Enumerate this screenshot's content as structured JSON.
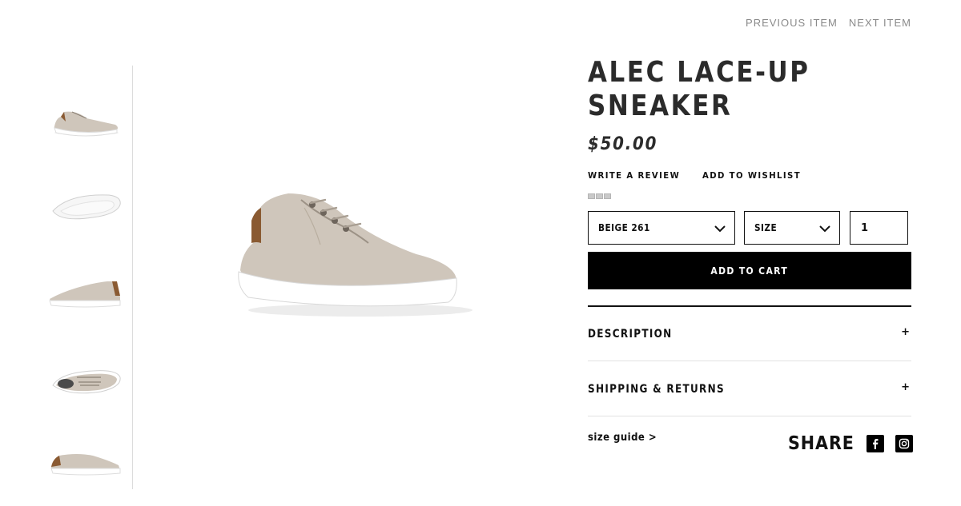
{
  "nav": {
    "previous": "PREVIOUS ITEM",
    "next": "NEXT ITEM"
  },
  "product": {
    "title": "ALEC LACE-UP SNEAKER",
    "price": "$50.00",
    "write_review": "WRITE A REVIEW",
    "add_wishlist": "ADD TO WISHLIST",
    "color_value": "BEIGE 261",
    "size_value": "SIZE",
    "quantity": "1",
    "add_to_cart": "ADD TO CART"
  },
  "thumbnails": [
    {
      "view": "three-quarter"
    },
    {
      "view": "sole"
    },
    {
      "view": "side"
    },
    {
      "view": "top"
    },
    {
      "view": "side-other"
    }
  ],
  "accordions": [
    {
      "label": "DESCRIPTION",
      "toggle": "+"
    },
    {
      "label": "SHIPPING & RETURNS",
      "toggle": "+"
    }
  ],
  "footer": {
    "size_guide": "size guide >",
    "share_label": "SHARE",
    "social_icons": [
      "facebook-icon",
      "instagram-icon"
    ]
  },
  "colors": {
    "shoe_upper": "#cfc6bb",
    "shoe_sole": "#ffffff",
    "heel_tab": "#8a5a32",
    "button_bg": "#000000",
    "nav_text": "#8a8a8a"
  }
}
